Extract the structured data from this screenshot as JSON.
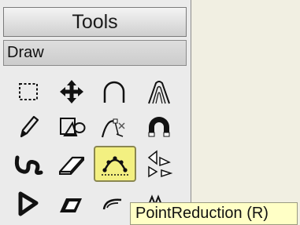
{
  "panel": {
    "title": "Tools",
    "section_label": "Draw"
  },
  "tools": [
    {
      "name": "select-rectangle",
      "icon": "dashed-rectangle-icon",
      "selected": false
    },
    {
      "name": "move",
      "icon": "four-way-arrow-icon",
      "selected": false
    },
    {
      "name": "arc",
      "icon": "arc-icon",
      "selected": false
    },
    {
      "name": "arch-3d",
      "icon": "arch-3d-icon",
      "selected": false
    },
    {
      "name": "pencil",
      "icon": "pencil-icon",
      "selected": false
    },
    {
      "name": "shapes",
      "icon": "shapes-icon",
      "selected": false
    },
    {
      "name": "curve-transform",
      "icon": "curve-transform-icon",
      "selected": false
    },
    {
      "name": "magnet",
      "icon": "magnet-icon",
      "selected": false
    },
    {
      "name": "freehand-curve",
      "icon": "freehand-curve-icon",
      "selected": false
    },
    {
      "name": "eraser",
      "icon": "eraser-icon",
      "selected": false
    },
    {
      "name": "point-reduction",
      "icon": "point-reduction-icon",
      "selected": true
    },
    {
      "name": "triangles",
      "icon": "triangles-icon",
      "selected": false
    },
    {
      "name": "flag",
      "icon": "flag-shape-icon",
      "selected": false
    },
    {
      "name": "offset-shape",
      "icon": "offset-shape-icon",
      "selected": false
    },
    {
      "name": "rotate",
      "icon": "rotate-icon",
      "selected": false
    },
    {
      "name": "wave",
      "icon": "wave-icon",
      "selected": false
    }
  ],
  "tooltip": {
    "text": "PointReduction (R)"
  },
  "colors": {
    "selected_bg": "#f3f081",
    "tooltip_bg": "#ffffc6",
    "workspace_bg": "#f1efe2"
  }
}
